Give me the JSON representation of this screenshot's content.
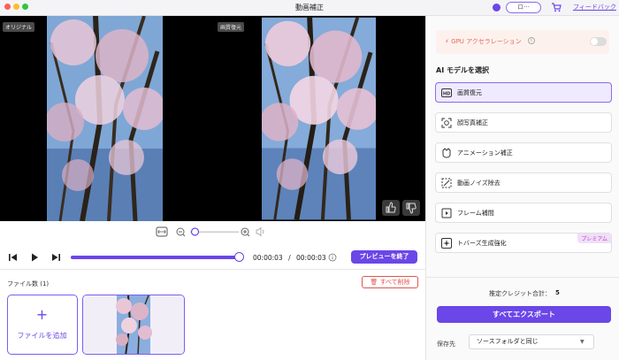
{
  "window": {
    "title": "動画補正"
  },
  "topbar": {
    "account_label": "ロ···",
    "feedback": "フィードバック"
  },
  "preview": {
    "original_tag": "オリジナル",
    "enhanced_tag": "画質復元"
  },
  "timeline": {
    "current_time": "00:00:03",
    "separator": "/",
    "total_time": "00:00:03",
    "progress": 1.0,
    "end_preview_button": "プレビューを終了"
  },
  "zoom": {
    "level": 0.1
  },
  "files": {
    "count_label": "ファイル数 (1)",
    "delete_all": "すべて削除",
    "add_plus": "+",
    "add_file": "ファイルを追加"
  },
  "sidebar": {
    "gpu_label": "GPU アクセラレーション",
    "gpu_info": "i",
    "gpu_enabled": false,
    "model_section_title": "AI モデルを選択",
    "models": [
      {
        "label": "画質復元",
        "icon": "hd-icon",
        "selected": true
      },
      {
        "label": "顔写真補正",
        "icon": "face-scan-icon"
      },
      {
        "label": "アニメーション補正",
        "icon": "anime-icon"
      },
      {
        "label": "動画ノイズ除去",
        "icon": "denoise-icon"
      },
      {
        "label": "フレーム補間",
        "icon": "frame-icon"
      },
      {
        "label": "トバーズ生成強化",
        "icon": "sparkle-icon",
        "badge": "プレミアム"
      }
    ],
    "credit_label": "推定クレジット合計：",
    "credit_value": "5",
    "export_button": "すべてエクスポート",
    "save_label": "保存先",
    "save_value": "ソースフォルダと同じ"
  },
  "colors": {
    "accent": "#6b46e8",
    "danger": "#e0554e",
    "gpu": "#e06a55",
    "premium": "#b83fd1"
  }
}
